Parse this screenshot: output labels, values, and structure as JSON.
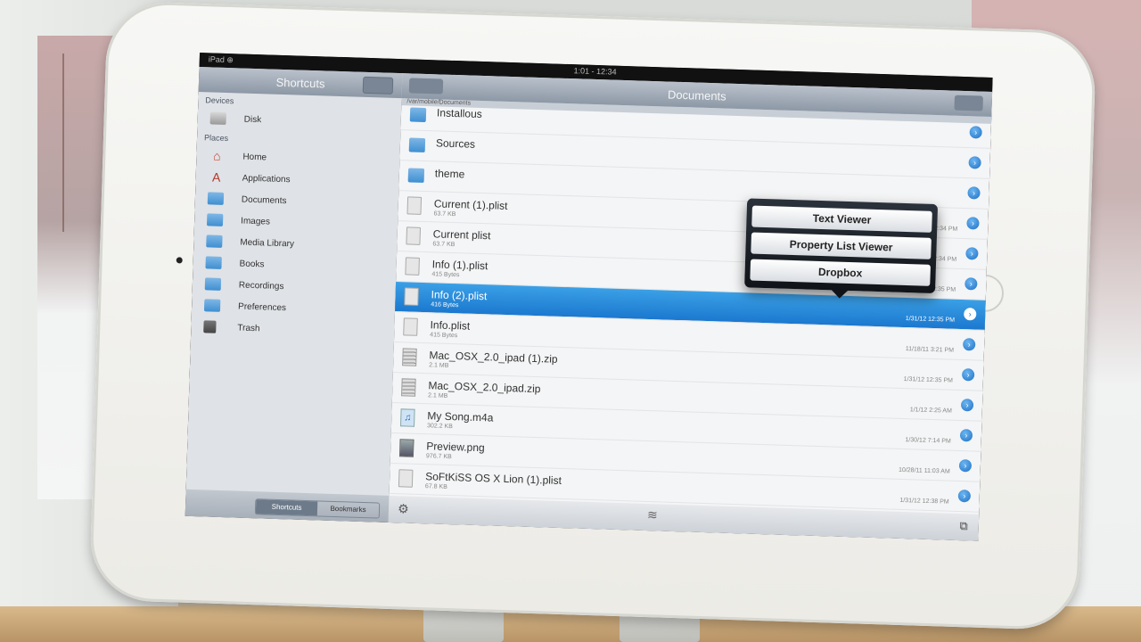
{
  "status": {
    "carrier": "iPad ⊕",
    "time": "1:01 - 12:34"
  },
  "sidebar": {
    "title": "Shortcuts",
    "sections": {
      "devices": "Devices",
      "places": "Places"
    },
    "devices": [
      {
        "label": "Disk",
        "icon": "disk-icon"
      }
    ],
    "places": [
      {
        "label": "Home",
        "icon": "home-icon"
      },
      {
        "label": "Applications",
        "icon": "applications-icon"
      },
      {
        "label": "Documents",
        "icon": "folder-icon"
      },
      {
        "label": "Images",
        "icon": "folder-icon"
      },
      {
        "label": "Media Library",
        "icon": "folder-icon"
      },
      {
        "label": "Books",
        "icon": "folder-icon"
      },
      {
        "label": "Recordings",
        "icon": "folder-icon"
      },
      {
        "label": "Preferences",
        "icon": "folder-icon"
      },
      {
        "label": "Trash",
        "icon": "trash-icon"
      }
    ],
    "tabs": {
      "shortcuts": "Shortcuts",
      "bookmarks": "Bookmarks"
    }
  },
  "main": {
    "title": "Documents",
    "path": "/var/mobile/Documents",
    "files": [
      {
        "name": "Installous",
        "size": "",
        "date": "",
        "type": "folder"
      },
      {
        "name": "Sources",
        "size": "",
        "date": "",
        "type": "folder"
      },
      {
        "name": "theme",
        "size": "",
        "date": "",
        "type": "folder"
      },
      {
        "name": "Current (1).plist",
        "size": "63.7 KB",
        "date": "1/31/12 12:34 PM",
        "type": "file"
      },
      {
        "name": "Current plist",
        "size": "63.7 KB",
        "date": "1/31/12 12:34 PM",
        "type": "file"
      },
      {
        "name": "Info (1).plist",
        "size": "415 Bytes",
        "date": "1/31/12 12:35 PM",
        "type": "file"
      },
      {
        "name": "Info (2).plist",
        "size": "416 Bytes",
        "date": "1/31/12 12:35 PM",
        "type": "file",
        "selected": true
      },
      {
        "name": "Info.plist",
        "size": "415 Bytes",
        "date": "11/18/11 3:21 PM",
        "type": "file"
      },
      {
        "name": "Mac_OSX_2.0_ipad (1).zip",
        "size": "2.1 MB",
        "date": "1/31/12 12:35 PM",
        "type": "zip"
      },
      {
        "name": "Mac_OSX_2.0_ipad.zip",
        "size": "2.1 MB",
        "date": "1/1/12 2:25 AM",
        "type": "zip"
      },
      {
        "name": "My Song.m4a",
        "size": "302.2 KB",
        "date": "1/30/12 7:14 PM",
        "type": "music"
      },
      {
        "name": "Preview.png",
        "size": "976.7 KB",
        "date": "10/28/11 11:03 AM",
        "type": "image"
      },
      {
        "name": "SoFtKiSS OS X Lion (1).plist",
        "size": "67.8 KB",
        "date": "1/31/12 12:38 PM",
        "type": "file"
      }
    ]
  },
  "popover": {
    "options": [
      "Text Viewer",
      "Property List Viewer",
      "Dropbox"
    ]
  }
}
